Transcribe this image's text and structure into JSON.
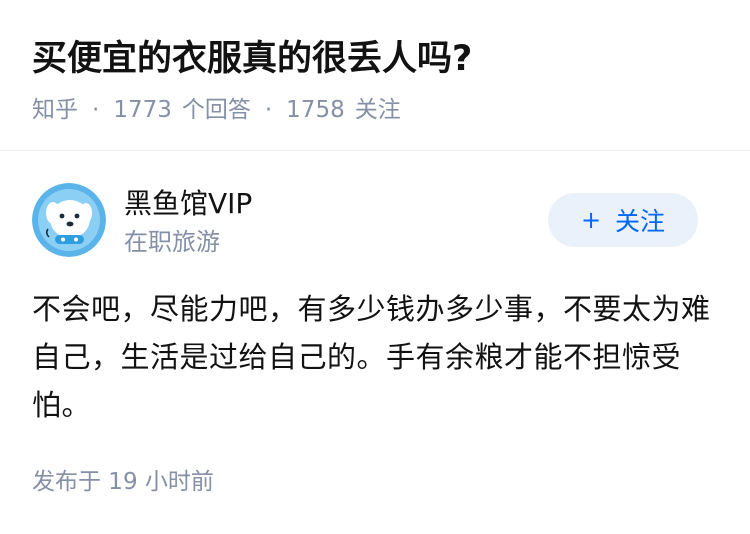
{
  "question": {
    "title": "买便宜的衣服真的很丢人吗?",
    "source": "知乎",
    "separator": "·",
    "answer_count": "1773",
    "answer_label": "个回答",
    "follower_count": "1758",
    "follower_label": "关注"
  },
  "answer": {
    "author_name": "黑鱼馆VIP",
    "author_bio": "在职旅游",
    "follow_plus": "+",
    "follow_label": "关注",
    "content": "不会吧，尽能力吧，有多少钱办多少事，不要太为难自己，生活是过给自己的。手有余粮才能不担惊受怕。",
    "time": "发布于 19 小时前"
  },
  "colors": {
    "accent": "#0066ff",
    "follow_bg": "#ebf1fa",
    "meta_gray": "#8590a6",
    "text": "#121212",
    "avatar_bg": "#5ab4ea"
  },
  "icons": {
    "avatar": "dog-avatar-icon",
    "follow": "plus-icon"
  }
}
